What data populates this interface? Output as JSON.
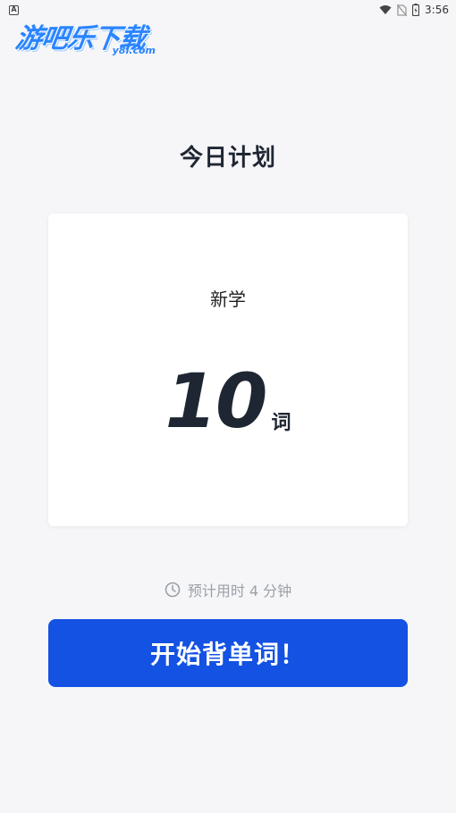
{
  "status_bar": {
    "notification_icon": "a-notification-icon",
    "time": "3:56",
    "icons": [
      "wifi-icon",
      "no-sim-icon",
      "battery-icon"
    ]
  },
  "watermark": {
    "main": "游吧乐下载",
    "sub": "y8l.com"
  },
  "page": {
    "title": "今日计划"
  },
  "plan_card": {
    "label": "新学",
    "count": "10",
    "unit": "词"
  },
  "estimate": {
    "icon": "clock-icon",
    "text": "预计用时 4 分钟"
  },
  "actions": {
    "start_label": "开始背单词！",
    "start_color": "#1352e2"
  }
}
